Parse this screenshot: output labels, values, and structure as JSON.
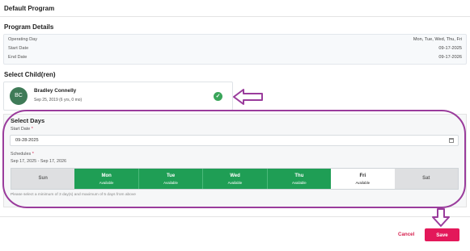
{
  "header": {
    "program_name": "Default Program"
  },
  "program_details": {
    "title": "Program Details",
    "rows": [
      {
        "label": "Operating Day",
        "value": "Mon, Tue, Wed, Thu, Fri"
      },
      {
        "label": "Start Date",
        "value": "09-17-2025"
      },
      {
        "label": "End Date",
        "value": "09-17-2026"
      }
    ]
  },
  "select_children": {
    "title": "Select Child(ren)",
    "child": {
      "initials": "BC",
      "name": "Bradley Connelly",
      "dob": "Sep 25, 2019 (6 yrs, 0 mo)"
    }
  },
  "select_days": {
    "title": "Select Days",
    "start_date_label": "Start Date",
    "start_date_value": "09-28-2025",
    "schedules_label": "Schedules",
    "schedule_range": "Sep 17, 2025 - Sep 17, 2026",
    "days": [
      {
        "name": "Sun",
        "status": ""
      },
      {
        "name": "Mon",
        "status": "Available"
      },
      {
        "name": "Tue",
        "status": "Available"
      },
      {
        "name": "Wed",
        "status": "Available"
      },
      {
        "name": "Thu",
        "status": "Available"
      },
      {
        "name": "Fri",
        "status": "Available"
      },
      {
        "name": "Sat",
        "status": ""
      }
    ],
    "hint": "Please select a minimum of 3 day(s) and maximum of 5 days from above"
  },
  "actions": {
    "cancel": "Cancel",
    "save": "Save"
  },
  "colors": {
    "accent": "#e3185a",
    "available": "#1f9e55",
    "annotation": "#9a3c9c",
    "avatar": "#3f7b58"
  }
}
